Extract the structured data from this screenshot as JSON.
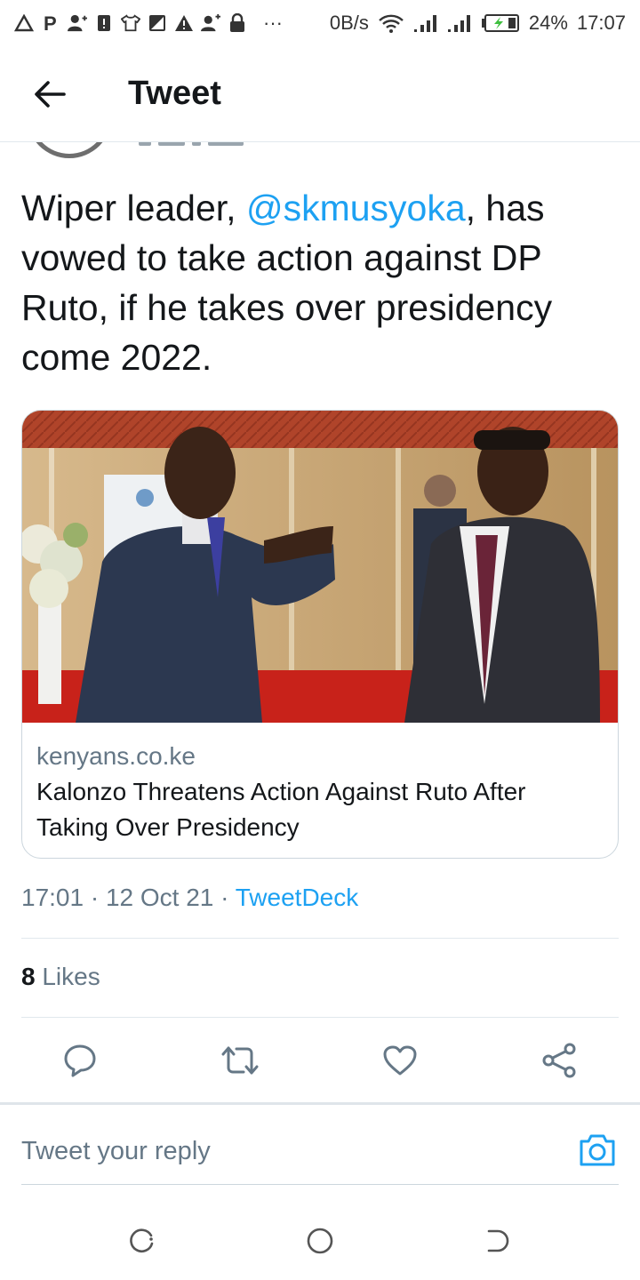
{
  "status_bar": {
    "net_speed": "0B/s",
    "battery": "24%",
    "time": "17:07",
    "icons": [
      "warning-icon",
      "parking-icon",
      "person-add-icon",
      "alert-box-icon",
      "shirt-icon",
      "signal-box-icon",
      "warning-icon",
      "person-add-icon",
      "lock-icon"
    ],
    "more": "···"
  },
  "header": {
    "title": "Tweet",
    "back_icon": "arrow-left-icon"
  },
  "tweet": {
    "text_before": "Wiper leader, ",
    "mention": "@skmusyoka",
    "text_after": ", has vowed to take action against DP Ruto, if he takes over presidency come 2022.",
    "timestamp": "17:01 · 12 Oct 21 · ",
    "source": "TweetDeck",
    "likes_count": "8",
    "likes_label": " Likes"
  },
  "card": {
    "domain": "kenyans.co.ke",
    "title": "Kalonzo Threatens Action Against Ruto After Taking Over Presidency"
  },
  "actions": {
    "reply_icon": "comment-icon",
    "retweet_icon": "retweet-icon",
    "like_icon": "heart-icon",
    "share_icon": "share-icon"
  },
  "reply": {
    "placeholder": "Tweet your reply",
    "camera_icon": "camera-icon"
  },
  "navbar": {
    "icons": [
      "recent-apps-icon",
      "home-icon",
      "back-icon"
    ]
  },
  "colors": {
    "accent": "#1da1f2",
    "text": "#14171a",
    "muted": "#657786",
    "border": "#e1e8ed"
  }
}
